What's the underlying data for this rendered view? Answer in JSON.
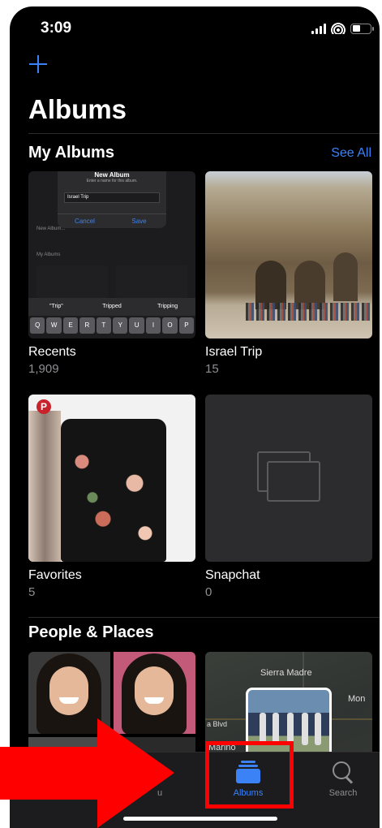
{
  "status_bar": {
    "time": "3:09"
  },
  "header": {
    "title": "Albums"
  },
  "my_albums": {
    "title": "My Albums",
    "see_all": "See All",
    "albums": [
      {
        "name": "Recents",
        "count": "1,909"
      },
      {
        "name": "Israel Trip",
        "count": "15"
      },
      {
        "name": "Favorites",
        "count": "5"
      },
      {
        "name": "Snapchat",
        "count": "0"
      }
    ],
    "recents_thumb": {
      "dialog_title": "New Album",
      "dialog_subtitle": "Enter a name for this album.",
      "field_value": "Israel Trip",
      "cancel": "Cancel",
      "save": "Save",
      "label_new": "New Album...",
      "label_my": "My Albums",
      "suggestions": [
        "\"Trip\"",
        "Tripped",
        "Tripping"
      ],
      "keys": [
        "Q",
        "W",
        "E",
        "R",
        "T",
        "Y",
        "U",
        "I",
        "O",
        "P"
      ]
    }
  },
  "people_places": {
    "title": "People & Places",
    "map_labels": {
      "sierra_madre": "Sierra Madre",
      "mon": "Mon",
      "blvd": "a Blvd",
      "marino": "Marino"
    }
  },
  "tabbar": {
    "for_you": "For You",
    "for_you_visible": "u",
    "albums": "Albums",
    "search": "Search"
  },
  "colors": {
    "accent": "#3b82f6",
    "annotation": "#ff0000",
    "background": "#000000"
  }
}
